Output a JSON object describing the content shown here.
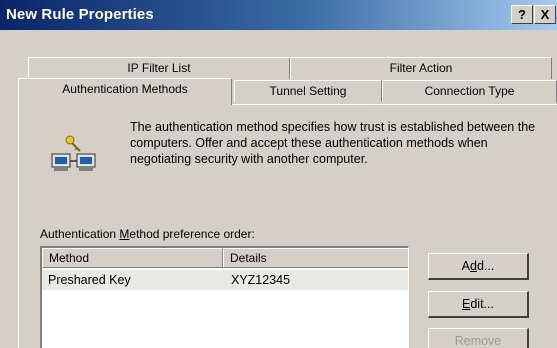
{
  "window": {
    "title": "New Rule Properties",
    "help_label": "?",
    "close_label": "X"
  },
  "tabs": {
    "row1": [
      {
        "label": "IP Filter List"
      },
      {
        "label": "Filter Action"
      }
    ],
    "row2": [
      {
        "label": "Authentication Methods",
        "active": true
      },
      {
        "label": "Tunnel Setting"
      },
      {
        "label": "Connection Type"
      }
    ]
  },
  "description": {
    "icon": "network-computers-key-icon",
    "text": "The authentication method specifies how trust is established between the computers. Offer and accept these authentication methods when negotiating security with another computer."
  },
  "preference": {
    "label_prefix": "Authentication ",
    "label_underlined": "M",
    "label_suffix": "ethod preference order:"
  },
  "table": {
    "columns": [
      "Method",
      "Details"
    ],
    "rows": [
      {
        "method": "Preshared Key",
        "details": "XYZ12345"
      }
    ]
  },
  "buttons": {
    "add": {
      "underlined": "d",
      "prefix": "A",
      "suffix": "d..."
    },
    "edit": {
      "underlined": "E",
      "prefix": "",
      "suffix": "dit..."
    },
    "remove": {
      "label": "Remove"
    }
  },
  "colors": {
    "titlebar_start": "#0a246a",
    "titlebar_end": "#a6caf0",
    "face": "#d4d0c8"
  }
}
